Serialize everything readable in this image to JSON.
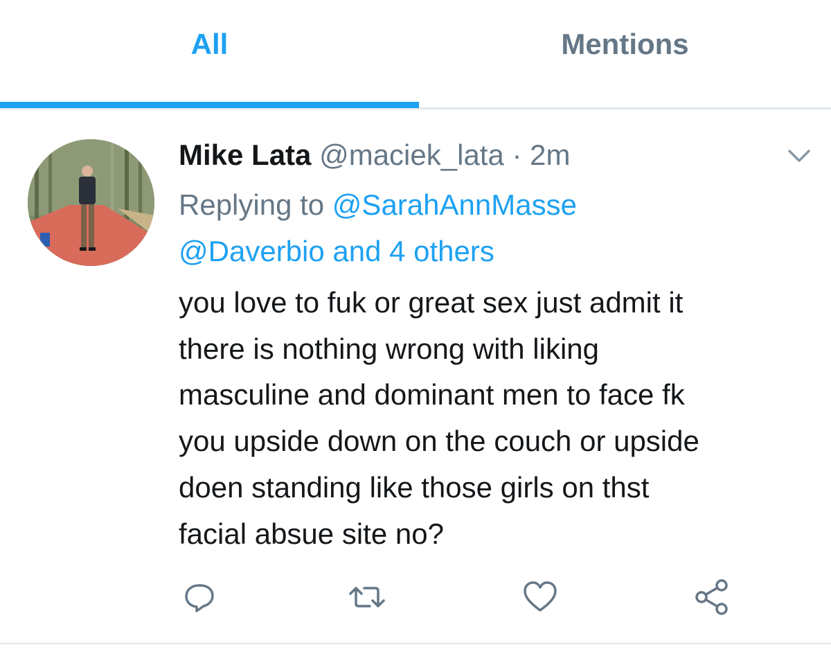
{
  "tabs": [
    {
      "label": "All",
      "active": true
    },
    {
      "label": "Mentions",
      "active": false
    }
  ],
  "colors": {
    "accent": "#1da1f2",
    "secondary_text": "#657786",
    "primary_text": "#14171a",
    "divider": "#e1e8ed"
  },
  "tweet": {
    "display_name": "Mike Lata",
    "handle": "@maciek_lata",
    "separator": "·",
    "time": "2m",
    "reply_prefix": "Replying to",
    "reply_mention_1": "@SarahAnnMasse",
    "reply_mention_2": "@Daverbio and 4 others",
    "text": "you love to fuk or great sex just admit it\nthere is nothing wrong with liking\nmasculine and dominant men to face fk\nyou upside down on the couch or upside\ndoen standing like those girls on thst\nfacial absue site no?",
    "menu_icon": "chevron-down-icon",
    "actions": [
      {
        "name": "reply",
        "icon": "reply-icon"
      },
      {
        "name": "retweet",
        "icon": "retweet-icon"
      },
      {
        "name": "like",
        "icon": "heart-icon"
      },
      {
        "name": "share",
        "icon": "share-icon"
      }
    ]
  }
}
